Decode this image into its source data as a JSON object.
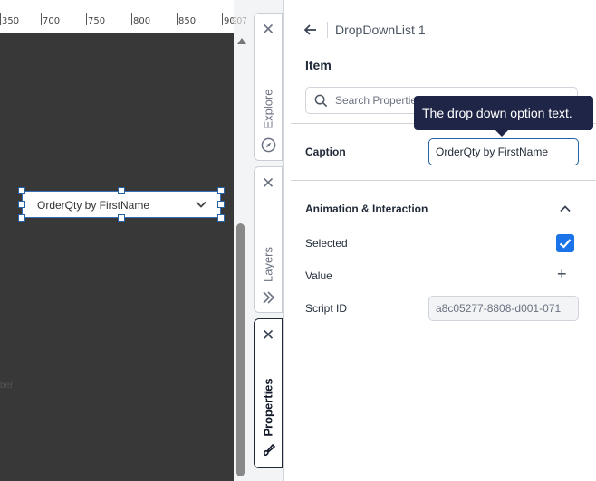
{
  "ruler": {
    "labels": [
      "350",
      "700",
      "750",
      "800",
      "850",
      "900"
    ],
    "overflow_label": "907"
  },
  "canvas": {
    "cut_text": "bel",
    "dropdown_widget": {
      "text": "OrderQty by FirstName"
    }
  },
  "tabs": [
    {
      "label": "Explore",
      "close_icon": "close-icon",
      "icon": "compass-icon"
    },
    {
      "label": "Layers",
      "close_icon": "close-icon",
      "icon": "layers-icon"
    },
    {
      "label": "Properties",
      "close_icon": "close-icon",
      "icon": "paint-brush-icon",
      "active": true
    }
  ],
  "panel": {
    "title": "DropDownList 1",
    "section": "Item",
    "search": {
      "placeholder": "Search Properties"
    },
    "tooltip": "The drop down option text.",
    "caption": {
      "label": "Caption",
      "value": "OrderQty by FirstName"
    },
    "animation": {
      "title": "Animation & Interaction",
      "selected_label": "Selected",
      "selected_checked": true,
      "value_label": "Value",
      "script_id_label": "Script ID",
      "script_id_value": "a8c05277-8808-d001-071"
    }
  },
  "colors": {
    "canvas_bg": "#383838",
    "accent": "#1a73e8",
    "tooltip_bg": "#1f2547",
    "selection": "#2563a6"
  }
}
